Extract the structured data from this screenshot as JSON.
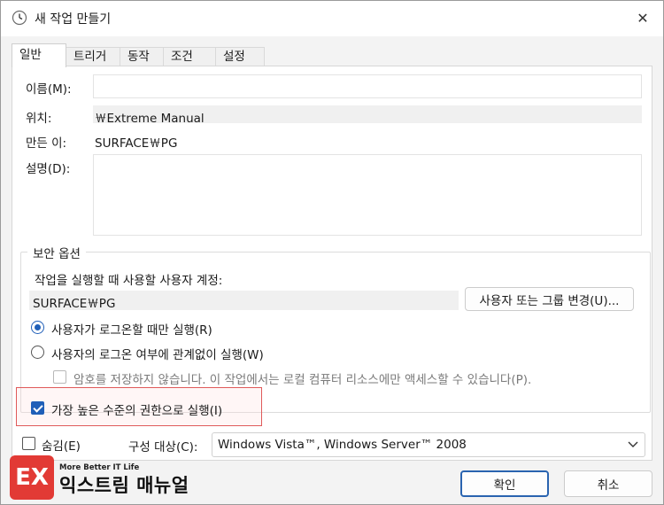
{
  "window": {
    "title": "새 작업 만들기",
    "icon": "clock-icon",
    "close_glyph": "✕"
  },
  "tabs": [
    {
      "label": "일반",
      "active": true
    },
    {
      "label": "트리거",
      "active": false
    },
    {
      "label": "동작",
      "active": false
    },
    {
      "label": "조건",
      "active": false
    },
    {
      "label": "설정",
      "active": false
    }
  ],
  "general": {
    "name_label": "이름(M):",
    "name_value": "",
    "location_label": "위치:",
    "location_value": "￦Extreme Manual",
    "author_label": "만든 이:",
    "author_value": "SURFACE￦PG",
    "description_label": "설명(D):",
    "description_value": ""
  },
  "security": {
    "group_title": "보안 옵션",
    "account_prompt": "작업을 실행할 때 사용할 사용자 계정:",
    "account_value": "SURFACE￦PG",
    "change_button": "사용자 또는 그룹 변경(U)...",
    "radio_logged_on": "사용자가 로그온할 때만 실행(R)",
    "radio_regardless": "사용자의 로그온 여부에 관계없이 실행(W)",
    "no_store_password": "암호를 저장하지 않습니다. 이 작업에서는 로컬 컴퓨터 리소스에만 액세스할 수 있습니다(P).",
    "highest_privileges": "가장 높은 수준의 권한으로 실행(I)",
    "selected_radio": "logged_on",
    "highest_checked": true
  },
  "bottom": {
    "hidden_label": "숨김(E)",
    "hidden_checked": false,
    "configure_label": "구성 대상(C):",
    "configure_value": "Windows Vista™, Windows Server™ 2008",
    "ok_button": "확인",
    "cancel_button": "취소"
  },
  "watermark": {
    "tagline": "More Better IT Life",
    "brand": "익스트림 매뉴얼",
    "logo_text": "EX"
  },
  "colors": {
    "accent": "#1f5fb8",
    "highlight_border": "#e05a5a",
    "logo": "#e23a35"
  }
}
